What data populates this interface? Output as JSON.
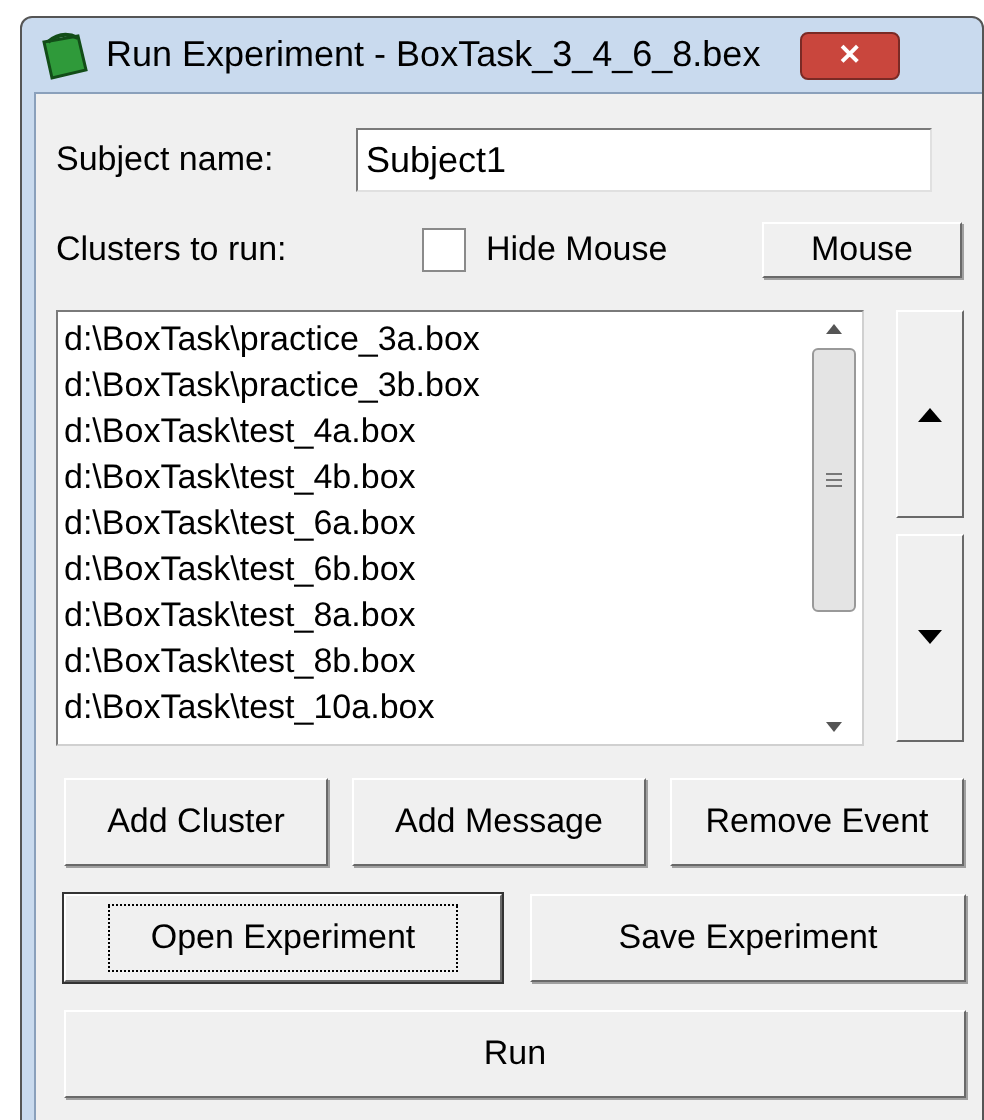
{
  "window": {
    "title": "Run Experiment - BoxTask_3_4_6_8.bex",
    "close": "✕"
  },
  "subject": {
    "label": "Subject name:",
    "value": "Subject1"
  },
  "clusters_label": "Clusters to run:",
  "hide_mouse": {
    "label": "Hide Mouse",
    "checked": false
  },
  "mouse_button": "Mouse",
  "clusters": [
    "d:\\BoxTask\\practice_3a.box",
    "d:\\BoxTask\\practice_3b.box",
    "d:\\BoxTask\\test_4a.box",
    "d:\\BoxTask\\test_4b.box",
    "d:\\BoxTask\\test_6a.box",
    "d:\\BoxTask\\test_6b.box",
    "d:\\BoxTask\\test_8a.box",
    "d:\\BoxTask\\test_8b.box",
    "d:\\BoxTask\\test_10a.box"
  ],
  "edit_buttons": [
    {
      "label": "Add Cluster",
      "focused": false
    },
    {
      "label": "Add Message",
      "focused": false
    },
    {
      "label": "Remove Event",
      "focused": false
    }
  ],
  "file_buttons": [
    {
      "label": "Open Experiment",
      "focused": true
    },
    {
      "label": "Save Experiment",
      "focused": false
    }
  ],
  "run_button": {
    "label": "Run",
    "focused": false
  }
}
